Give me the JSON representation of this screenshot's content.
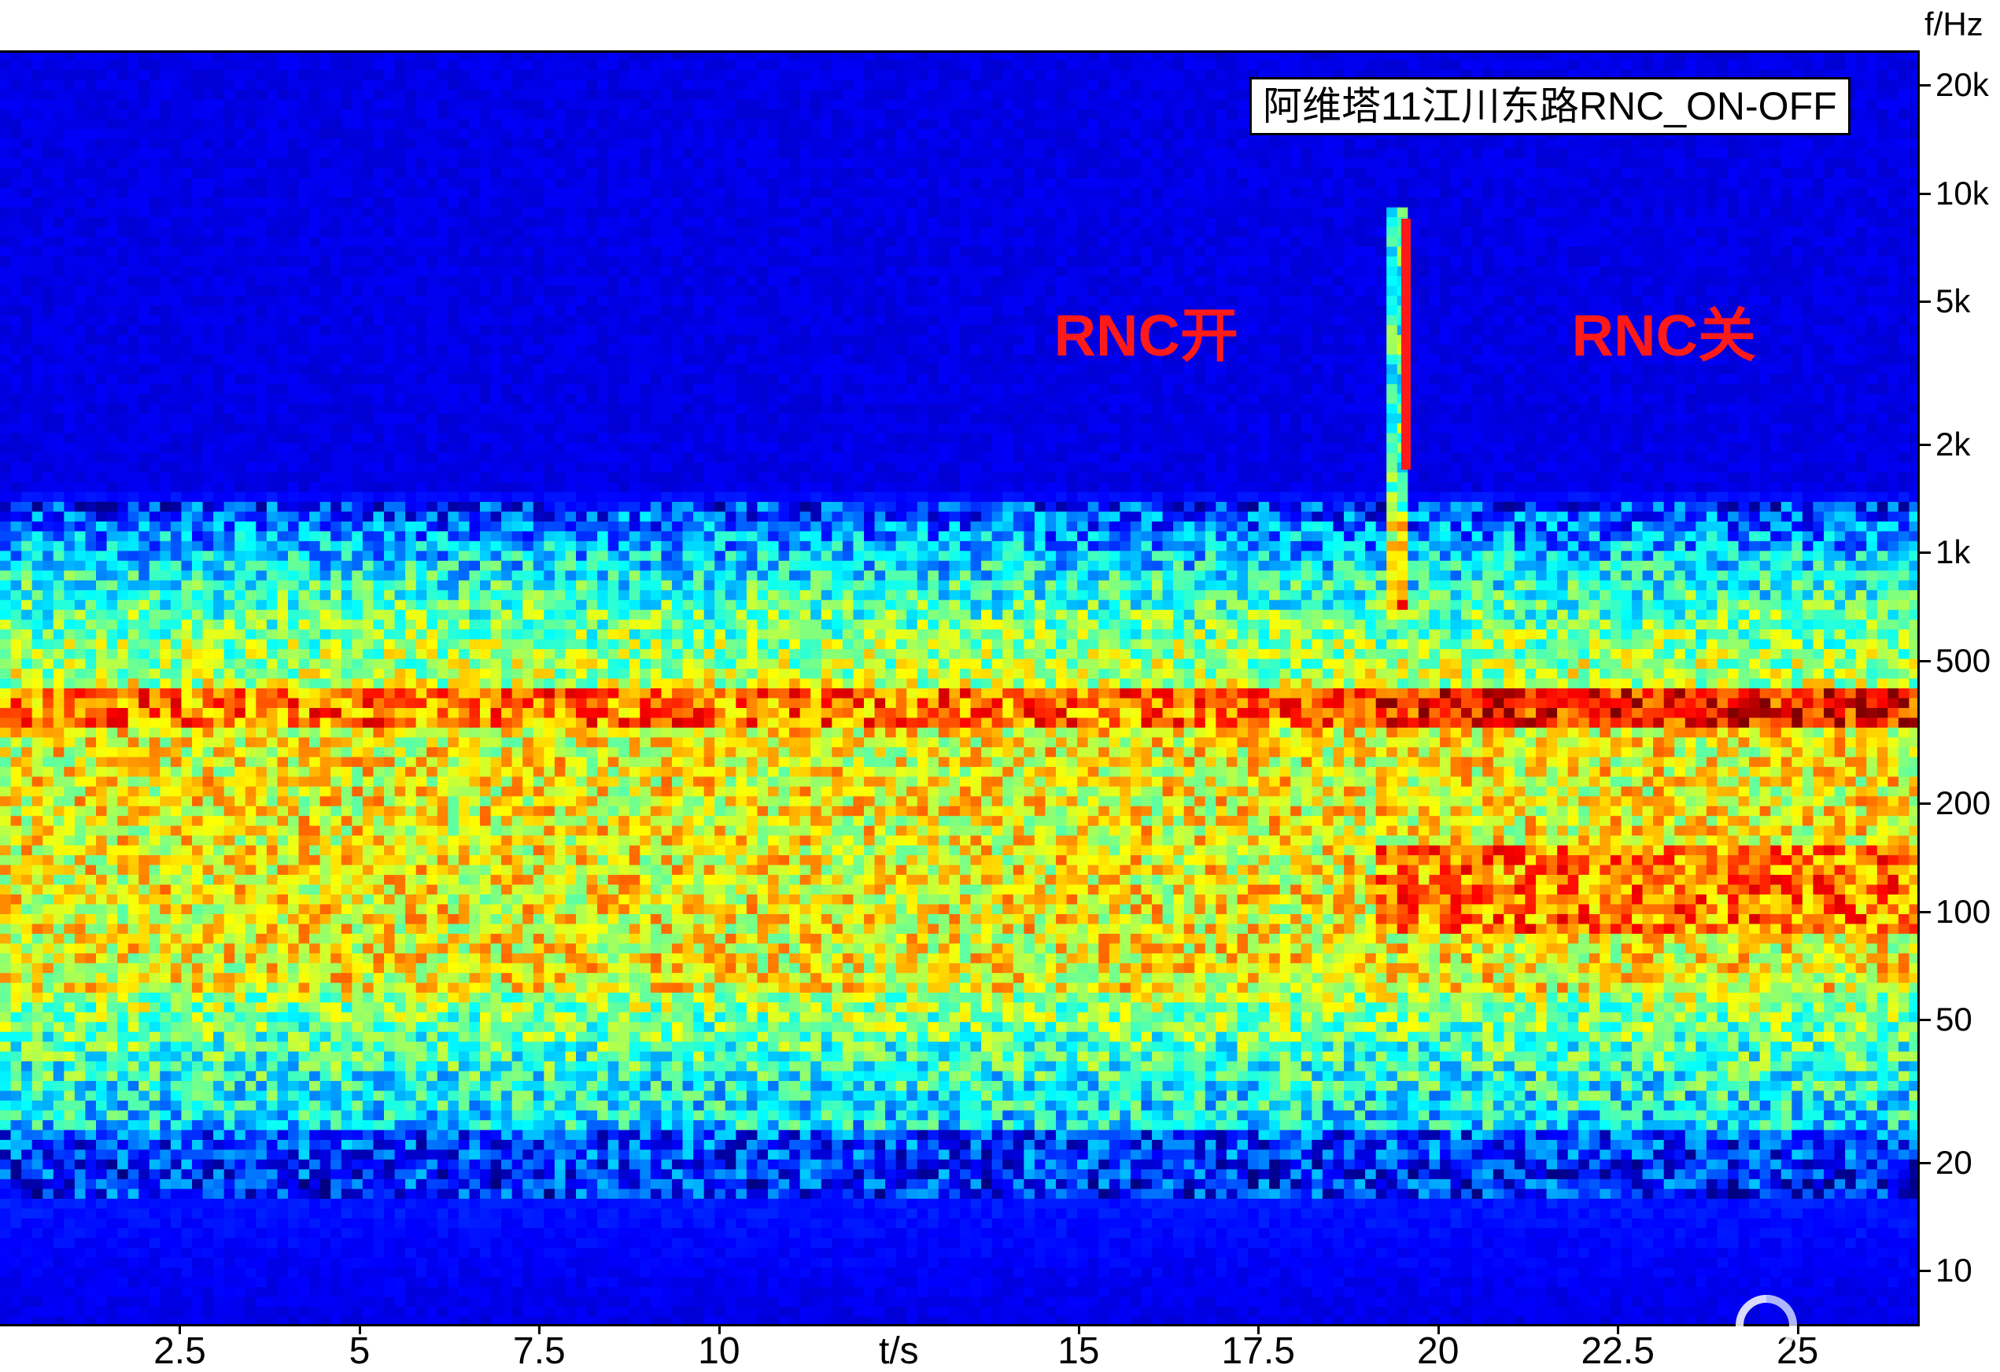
{
  "chart_data": {
    "type": "heatmap",
    "title": "阿维塔11江川东路RNC_ON-OFF",
    "xlabel": "t/s",
    "ylabel": "f/Hz",
    "xlim": [
      0,
      26.7
    ],
    "ylim": [
      7,
      25000
    ],
    "y_scale": "log",
    "x_ticks": [
      "2.5",
      "5",
      "7.5",
      "10",
      "15",
      "17.5",
      "20",
      "22.5",
      "25"
    ],
    "x_tick_values": [
      2.5,
      5,
      7.5,
      10,
      15,
      17.5,
      20,
      22.5,
      25
    ],
    "y_ticks": [
      "20k",
      "10k",
      "5k",
      "2k",
      "1k",
      "500",
      "200",
      "100",
      "50",
      "20",
      "10"
    ],
    "y_tick_values": [
      20000,
      10000,
      5000,
      2000,
      1000,
      500,
      200,
      100,
      50,
      20,
      10
    ],
    "annotations": [
      {
        "text": "RNC开",
        "x": 16.3,
        "y": 4000
      },
      {
        "text": "RNC关",
        "x": 23.5,
        "y": 4000
      }
    ],
    "marker_line": {
      "x": 19.55,
      "y_range": [
        1700,
        8500
      ]
    },
    "colormap": "jet",
    "colors": {
      "background": "#0a10f0",
      "annotation": "#ff1a1a"
    }
  }
}
